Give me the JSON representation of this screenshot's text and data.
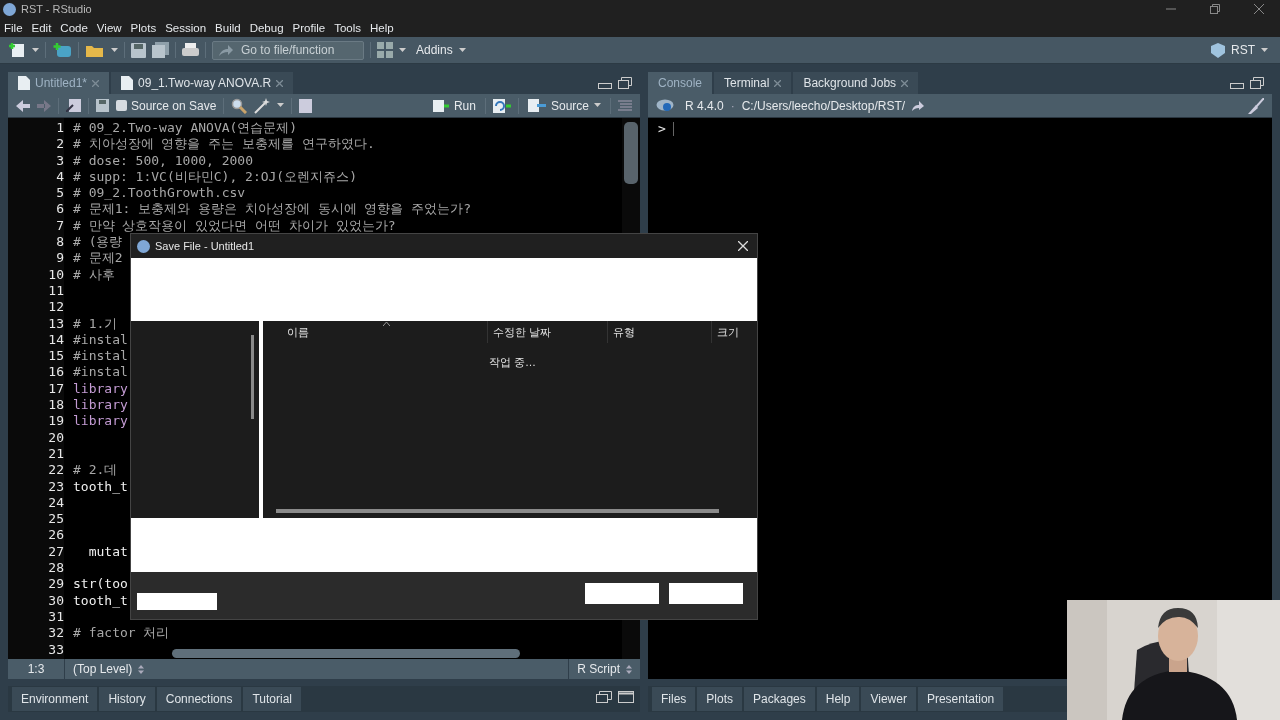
{
  "window": {
    "title": "RST - RStudio"
  },
  "menu": [
    "File",
    "Edit",
    "Code",
    "View",
    "Plots",
    "Session",
    "Build",
    "Debug",
    "Profile",
    "Tools",
    "Help"
  ],
  "toolbar": {
    "goto_placeholder": "Go to file/function",
    "addins": "Addins",
    "project": "RST"
  },
  "source_pane": {
    "tabs": [
      {
        "label": "Untitled1*",
        "selected": true
      },
      {
        "label": "09_1.Two-way ANOVA.R",
        "selected": false
      }
    ],
    "source_on_save": {
      "label": "Source on Save",
      "checked": false
    },
    "run": "Run",
    "source": "Source",
    "lines": [
      {
        "number": "1",
        "kind": "comment",
        "text": "# 09_2.Two-way ANOVA(연습문제)"
      },
      {
        "number": "2",
        "kind": "comment",
        "text": "# 치아성장에 영향을 주는 보충제를 연구하였다."
      },
      {
        "number": "3",
        "kind": "comment",
        "text": "# dose: 500, 1000, 2000"
      },
      {
        "number": "4",
        "kind": "comment",
        "text": "# supp: 1:VC(비타민C), 2:OJ(오렌지쥬스)"
      },
      {
        "number": "5",
        "kind": "comment",
        "text": "# 09_2.ToothGrowth.csv"
      },
      {
        "number": "6",
        "kind": "comment",
        "text": "# 문제1: 보충제와 용량은 치아성장에 동시에 영향을 주었는가?"
      },
      {
        "number": "7",
        "kind": "comment",
        "text": "# 만약 상호작용이 있었다면 어떤 차이가 있었는가?"
      },
      {
        "number": "8",
        "kind": "comment",
        "text": "# (용량"
      },
      {
        "number": "9",
        "kind": "comment",
        "text": "# 문제2"
      },
      {
        "number": "10",
        "kind": "comment",
        "text": "# 사후"
      },
      {
        "number": "11",
        "kind": "blank"
      },
      {
        "number": "12",
        "kind": "blank"
      },
      {
        "number": "13",
        "kind": "comment",
        "text": "# 1.기"
      },
      {
        "number": "14",
        "kind": "comment",
        "text": "#instal"
      },
      {
        "number": "15",
        "kind": "comment",
        "text": "#instal"
      },
      {
        "number": "16",
        "kind": "comment",
        "text": "#instal"
      },
      {
        "number": "17",
        "kind": "keyword",
        "text": "library"
      },
      {
        "number": "18",
        "kind": "keyword",
        "text": "library"
      },
      {
        "number": "19",
        "kind": "keyword",
        "text": "library"
      },
      {
        "number": "20",
        "kind": "blank"
      },
      {
        "number": "21",
        "kind": "blank"
      },
      {
        "number": "22",
        "kind": "comment",
        "text": "# 2.데"
      },
      {
        "number": "23",
        "kind": "code",
        "text": "tooth_t"
      },
      {
        "number": "24",
        "kind": "blank"
      },
      {
        "number": "25",
        "kind": "blank"
      },
      {
        "number": "26",
        "kind": "blank"
      },
      {
        "number": "27",
        "kind": "code",
        "text": "  mutat"
      },
      {
        "number": "28",
        "kind": "blank"
      },
      {
        "number": "29",
        "kind": "code",
        "text": "str(too"
      },
      {
        "number": "30",
        "kind": "code",
        "text": "tooth_t"
      },
      {
        "number": "31",
        "kind": "blank"
      },
      {
        "number": "32",
        "kind": "comment",
        "text": "# factor 처리"
      },
      {
        "number": "33",
        "kind": "blank"
      }
    ],
    "status": {
      "position": "1:3",
      "scope": "(Top Level)",
      "file_type": "R Script"
    }
  },
  "console_pane": {
    "tabs": [
      {
        "label": "Console",
        "selected": true,
        "closable": false
      },
      {
        "label": "Terminal",
        "selected": false,
        "closable": true
      },
      {
        "label": "Background Jobs",
        "selected": false,
        "closable": true
      }
    ],
    "version": "R 4.4.0",
    "separator": "·",
    "path": "C:/Users/leecho/Desktop/RST/",
    "prompt": ">"
  },
  "dialog": {
    "title": "Save File - Untitled1",
    "columns": [
      "이름",
      "수정한 날짜",
      "유형",
      "크기"
    ],
    "status": "작업 중…"
  },
  "bottom_left_tabs": [
    "Environment",
    "History",
    "Connections",
    "Tutorial"
  ],
  "bottom_right_tabs": [
    "Files",
    "Plots",
    "Packages",
    "Help",
    "Viewer",
    "Presentation"
  ]
}
